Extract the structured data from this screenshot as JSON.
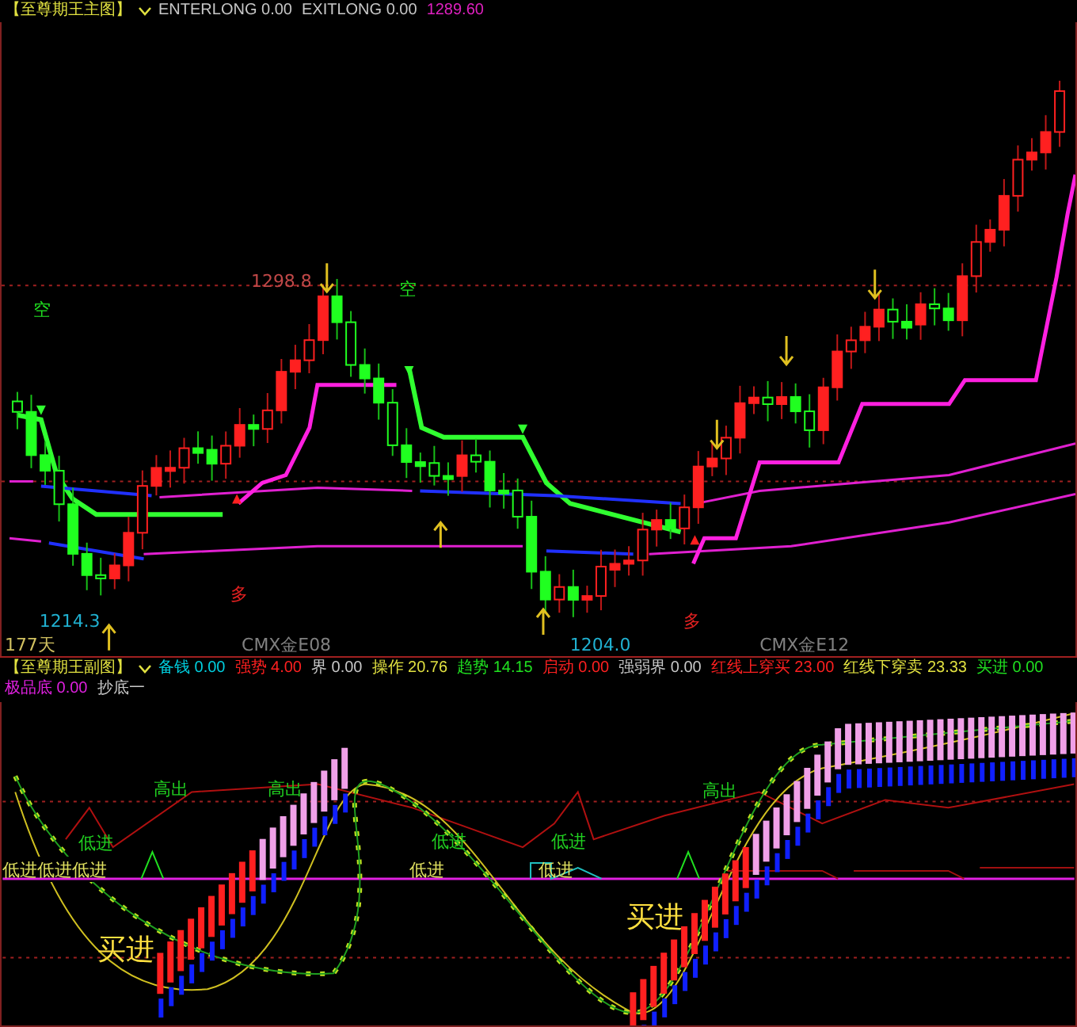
{
  "main_header": {
    "title": "【至尊期王主图】",
    "items": [
      {
        "label": "ENTERLONG",
        "value": "0.00",
        "color": "#c8c8c8"
      },
      {
        "label": "EXITLONG",
        "value": "0.00",
        "color": "#c8c8c8"
      },
      {
        "value": "1289.60",
        "color": "#e020c0"
      }
    ]
  },
  "main_chart": {
    "labels": [
      {
        "text": "1298.8",
        "kind": "high"
      },
      {
        "text": "空",
        "kind": "short"
      },
      {
        "text": "空",
        "kind": "short"
      },
      {
        "text": "多",
        "kind": "long"
      },
      {
        "text": "多",
        "kind": "long"
      },
      {
        "text": "1214.3",
        "kind": "low"
      },
      {
        "text": "177天",
        "kind": "period"
      },
      {
        "text": "CMX金E08",
        "kind": "contract"
      },
      {
        "text": "1204.0",
        "kind": "low"
      },
      {
        "text": "CMX金E12",
        "kind": "contract"
      }
    ]
  },
  "sub_header": {
    "title": "【至尊期王副图】",
    "items": [
      {
        "label": "备钱",
        "value": "0.00",
        "color": "#00d0e0"
      },
      {
        "label": "强势",
        "value": "4.00",
        "color": "#ff2020"
      },
      {
        "label": "界",
        "value": "0.00",
        "color": "#c8c8c8"
      },
      {
        "label": "操作",
        "value": "20.76",
        "color": "#e0e040"
      },
      {
        "label": "趋势",
        "value": "14.15",
        "color": "#20e020"
      },
      {
        "label": "启动",
        "value": "0.00",
        "color": "#ff2020"
      },
      {
        "label": "强弱界",
        "value": "0.00",
        "color": "#c8c8c8"
      },
      {
        "label": "红线上穿买",
        "value": "23.00",
        "color": "#ff2020"
      },
      {
        "label": "红线下穿卖",
        "value": "23.33",
        "color": "#e0e040"
      },
      {
        "label": "买进",
        "value": "0.00",
        "color": "#20e020"
      },
      {
        "label": "极品底",
        "value": "0.00",
        "color": "#e020e0"
      },
      {
        "label": "抄底一",
        "color": "#c8c8c8"
      }
    ]
  },
  "sub_chart": {
    "labels": [
      {
        "text": "高出",
        "kind": "exit"
      },
      {
        "text": "高出",
        "kind": "exit"
      },
      {
        "text": "高出",
        "kind": "exit"
      },
      {
        "text": "低进",
        "kind": "entry"
      },
      {
        "text": "低进低进低进",
        "kind": "entry_alt"
      },
      {
        "text": "低进",
        "kind": "entry"
      },
      {
        "text": "低进",
        "kind": "entry_alt"
      },
      {
        "text": "低进",
        "kind": "entry"
      },
      {
        "text": "低进",
        "kind": "entry_alt"
      },
      {
        "text": "买进",
        "kind": "buy"
      },
      {
        "text": "买进",
        "kind": "buy"
      }
    ]
  }
}
